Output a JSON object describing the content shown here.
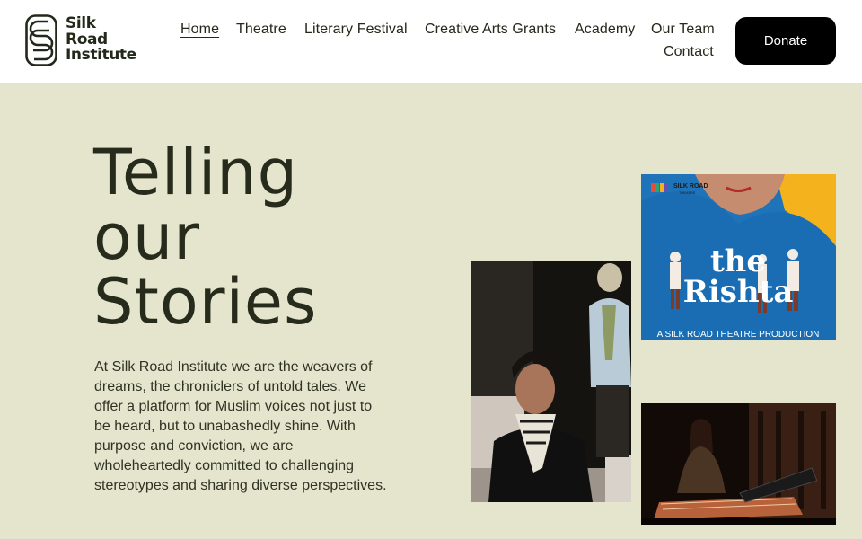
{
  "brand": {
    "name_lines": [
      "Silk",
      "Road",
      "Institute"
    ]
  },
  "nav": {
    "items": [
      {
        "label": "Home",
        "active": true
      },
      {
        "label": "Theatre"
      },
      {
        "label": "Literary Festival"
      },
      {
        "label": "Creative Arts Grants"
      },
      {
        "label": "Academy"
      },
      {
        "label": "Our Team"
      },
      {
        "label": "Contact"
      }
    ]
  },
  "donate_label": "Donate",
  "hero": {
    "title_lines": [
      "Telling",
      "our",
      "Stories"
    ],
    "body": "At Silk Road Institute we are the weavers of dreams, the chroniclers of untold tales. We offer a platform for Muslim voices not just to be heard, but to unabashedly shine. With purpose and conviction, we are wholeheartedly committed to challenging stereotypes and sharing diverse perspectives."
  },
  "poster": {
    "brand_line1": "SILK ROAD",
    "brand_line2": "THEATRE",
    "title_the": "the",
    "title_main": "Rishta",
    "caption": "A SILK ROAD THEATRE PRODUCTION"
  },
  "colors": {
    "page_bg": "#e5e4cd",
    "header_bg": "#ffffff",
    "text": "#24291b",
    "donate_bg": "#000000",
    "poster_blue": "#1f73b8",
    "poster_yellow": "#f4b21d"
  }
}
